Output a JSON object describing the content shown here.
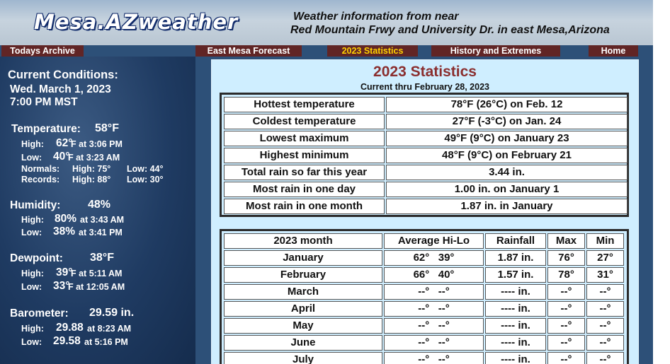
{
  "header": {
    "logo": "Mesa.AZweather",
    "tagline1": "Weather information from near",
    "tagline2": "Red Mountain Frwy and University Dr. in east Mesa,Arizona"
  },
  "nav": [
    {
      "label": "Todays Archive",
      "active": false
    },
    {
      "label": "East Mesa Forecast",
      "active": false
    },
    {
      "label": "2023 Statistics",
      "active": true
    },
    {
      "label": "History and Extremes",
      "active": false
    },
    {
      "label": "Home",
      "active": false
    }
  ],
  "conditions": {
    "heading": "Current Conditions:",
    "date": "Wed.  March 1, 2023",
    "time": "7:00 PM MST",
    "temperature": {
      "label": "Temperature:",
      "value": "58°F",
      "high_label": "High:",
      "high_value": "62°",
      "high_detail": "F at 3:06 PM",
      "low_label": "Low:",
      "low_value": "40°",
      "low_detail": "F at 3:23 AM",
      "normals_label": "Normals:",
      "normals_high": "High:  75°",
      "normals_low": "Low:  44°",
      "records_label": "Records:",
      "records_high": "High:  88°",
      "records_low": "Low:  30°"
    },
    "humidity": {
      "label": "Humidity:",
      "value": "48%",
      "high_label": "High:",
      "high_value": "80%",
      "high_detail": "at 3:43 AM",
      "low_label": "Low:",
      "low_value": "38%",
      "low_detail": "at 3:41 PM"
    },
    "dewpoint": {
      "label": "Dewpoint:",
      "value": "38°F",
      "high_label": "High:",
      "high_value": "39°",
      "high_detail": "F at 5:11 AM",
      "low_label": "Low:",
      "low_value": "33°",
      "low_detail": "F at 12:05 AM"
    },
    "barometer": {
      "label": "Barometer:",
      "value": "29.59 in.",
      "high_label": "High:",
      "high_value": "29.88",
      "high_detail": "at 8:23 AM",
      "low_label": "Low:",
      "low_value": "29.58",
      "low_detail": "at 5:16 PM"
    }
  },
  "stats": {
    "title": "2023 Statistics",
    "subtitle": "Current thru February 28, 2023",
    "summary": [
      [
        "Hottest temperature",
        "78°F (26°C) on Feb. 12"
      ],
      [
        "Coldest temperature",
        "27°F (-3°C) on Jan. 24"
      ],
      [
        "Lowest maximum",
        "49°F (9°C) on January 23"
      ],
      [
        "Highest minimum",
        "48°F (9°C) on February 21"
      ],
      [
        "Total rain so far this year",
        "3.44 in."
      ],
      [
        "Most rain in one day",
        "1.00 in. on January 1"
      ],
      [
        "Most rain in one month",
        "1.87 in. in January"
      ]
    ],
    "monthly_headers": [
      "2023 month",
      "Average Hi-Lo",
      "Rainfall",
      "Max",
      "Min"
    ],
    "monthly": [
      [
        "January",
        "62°   39°",
        "1.87 in.",
        "76°",
        "27°"
      ],
      [
        "February",
        "66°   40°",
        "1.57 in.",
        "78°",
        "31°"
      ],
      [
        "March",
        "--°   --°",
        "---- in.",
        "--°",
        "--°"
      ],
      [
        "April",
        "--°   --°",
        "---- in.",
        "--°",
        "--°"
      ],
      [
        "May",
        "--°   --°",
        "---- in.",
        "--°",
        "--°"
      ],
      [
        "June",
        "--°   --°",
        "---- in.",
        "--°",
        "--°"
      ],
      [
        "July",
        "--°   --°",
        "---- in.",
        "--°",
        "--°"
      ]
    ]
  }
}
